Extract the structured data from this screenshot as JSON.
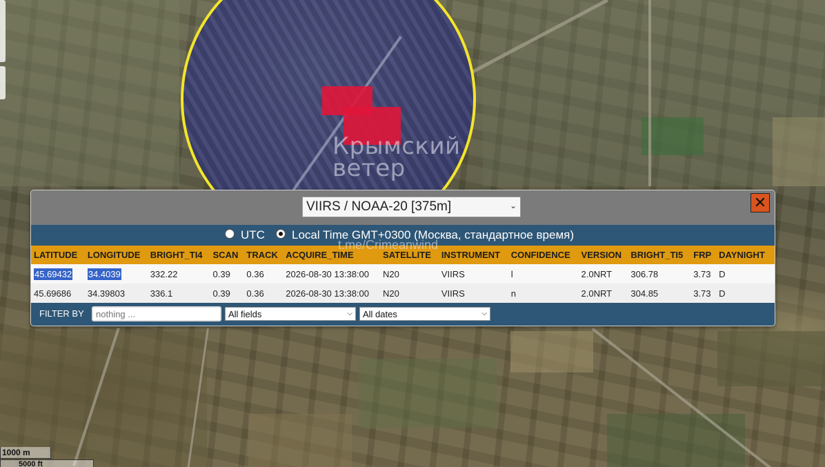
{
  "map": {
    "watermark_line1": "Крымский",
    "watermark_line2": "ветер",
    "watermark_url": "t.me/Crimeanwind",
    "scale_metric": "1000 m",
    "scale_imperial": "5000 ft",
    "circle_color": "#f3e52a",
    "fire_color": "#e0163a"
  },
  "panel": {
    "product_select": "VIIRS / NOAA-20 [375m]",
    "close_label": "✕",
    "time_options": {
      "utc_label": "UTC",
      "local_label": "Local Time GMT+0300 (Москва, стандартное время)",
      "selected": "local"
    },
    "columns": [
      "LATITUDE",
      "LONGITUDE",
      "BRIGHT_TI4",
      "SCAN",
      "TRACK",
      "ACQUIRE_TIME",
      "SATELLITE",
      "INSTRUMENT",
      "CONFIDENCE",
      "VERSION",
      "BRIGHT_TI5",
      "FRP",
      "DAYNIGHT"
    ],
    "rows": [
      [
        "45.69432",
        "34.4039",
        "332.22",
        "0.39",
        "0.36",
        "2026-08-30 13:38:00",
        "N20",
        "VIIRS",
        "l",
        "2.0NRT",
        "306.78",
        "3.73",
        "D"
      ],
      [
        "45.69686",
        "34.39803",
        "336.1",
        "0.39",
        "0.36",
        "2026-08-30 13:38:00",
        "N20",
        "VIIRS",
        "n",
        "2.0NRT",
        "304.85",
        "3.73",
        "D"
      ]
    ],
    "filter": {
      "label": "FILTER BY",
      "placeholder": "nothing ...",
      "fields_select": "All fields",
      "dates_select": "All dates"
    },
    "colors": {
      "header_bg": "#e09a10",
      "bar_bg": "#2e5676",
      "close_bg": "#d9541e",
      "selection": "#3563c9"
    }
  }
}
